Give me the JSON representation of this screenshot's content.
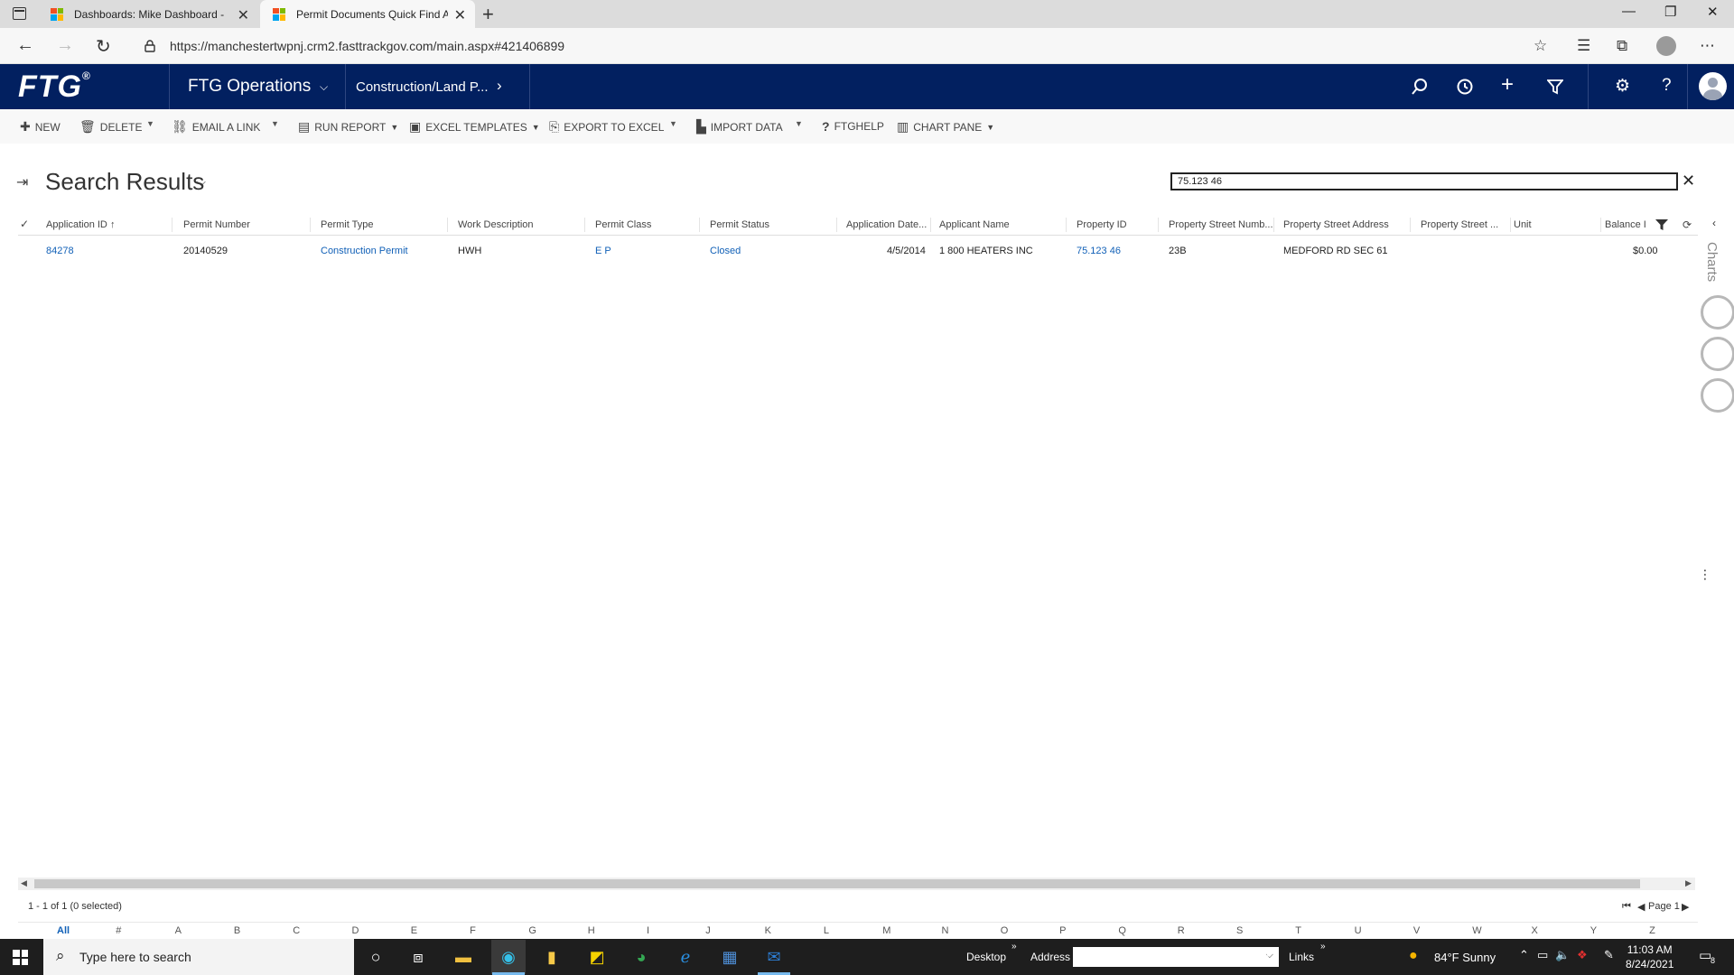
{
  "browser": {
    "tabs": [
      {
        "label": "Dashboards: Mike Dashboard - Mi",
        "active": false
      },
      {
        "label": "Permit Documents Quick Find Ac",
        "active": true
      }
    ],
    "url": "https://manchestertwpnj.crm2.fasttrackgov.com/main.aspx#421406899"
  },
  "app": {
    "logo": "FTG",
    "logo_mark": "®",
    "name": "FTG Operations",
    "area": "Construction/Land P..."
  },
  "commands": {
    "new": "NEW",
    "delete": "DELETE",
    "email_link": "EMAIL A LINK",
    "run_report": "RUN REPORT",
    "excel_templates": "EXCEL TEMPLATES",
    "export_excel": "EXPORT TO EXCEL",
    "import_data": "IMPORT DATA",
    "ftghelp": "FTGHELP",
    "chart_pane": "CHART PANE"
  },
  "view": {
    "title": "Search Results",
    "quickfind_value": "75.123 46"
  },
  "grid": {
    "columns": [
      "Application ID",
      "Permit Number",
      "Permit Type",
      "Work Description",
      "Permit Class",
      "Permit Status",
      "Application Date...",
      "Applicant Name",
      "Property ID",
      "Property Street Numb...",
      "Property Street Address",
      "Property Street ...",
      "Unit",
      "Balance I"
    ],
    "rows": [
      {
        "application_id": "84278",
        "permit_number": "20140529",
        "permit_type": "Construction Permit",
        "work_description": "HWH",
        "permit_class": "E P",
        "permit_status": "Closed",
        "application_date": "4/5/2014",
        "applicant_name": "1 800 HEATERS INC",
        "property_id": "75.123 46",
        "street_number": "23B",
        "street_address": "MEDFORD RD SEC 61",
        "street_extra": "",
        "unit": "",
        "balance": "$0.00"
      }
    ],
    "status": "1 - 1 of 1 (0 selected)",
    "page_label": "Page 1"
  },
  "right_rail": {
    "charts_label": "Charts"
  },
  "alpha_index": [
    "All",
    "#",
    "A",
    "B",
    "C",
    "D",
    "E",
    "F",
    "G",
    "H",
    "I",
    "J",
    "K",
    "L",
    "M",
    "N",
    "O",
    "P",
    "Q",
    "R",
    "S",
    "T",
    "U",
    "V",
    "W",
    "X",
    "Y",
    "Z"
  ],
  "taskbar": {
    "search_placeholder": "Type here to search",
    "desktop": "Desktop",
    "address": "Address",
    "links": "Links",
    "weather": "84°F  Sunny",
    "time": "11:03 AM",
    "date": "8/24/2021",
    "notifications": "8"
  },
  "colors": {
    "header_bg": "#022060",
    "link": "#1160b7",
    "taskbar_bg": "#1e1e1e"
  }
}
